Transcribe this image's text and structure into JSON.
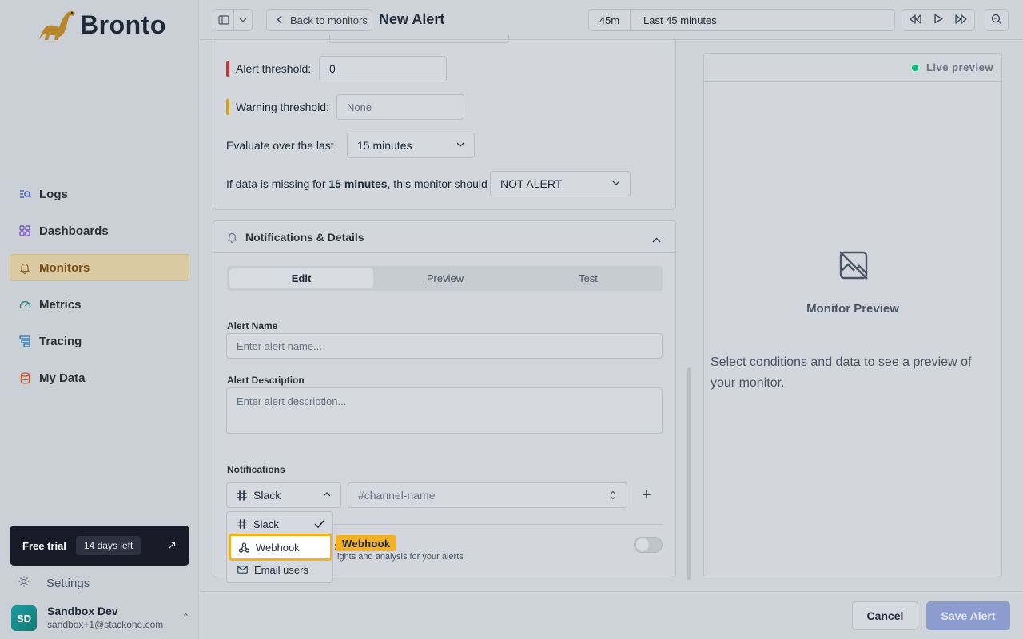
{
  "app": {
    "brand": "Bronto"
  },
  "sidebar": {
    "items": [
      {
        "label": "Logs",
        "icon": "logs-icon"
      },
      {
        "label": "Dashboards",
        "icon": "dashboards-icon"
      },
      {
        "label": "Monitors",
        "icon": "bell-icon",
        "active": true
      },
      {
        "label": "Metrics",
        "icon": "gauge-icon"
      },
      {
        "label": "Tracing",
        "icon": "tracing-icon"
      },
      {
        "label": "My Data",
        "icon": "database-icon"
      }
    ],
    "trial": {
      "title": "Free trial",
      "badge": "14 days left"
    },
    "settings_label": "Settings",
    "user": {
      "initials": "SD",
      "name": "Sandbox Dev",
      "email": "sandbox+1@stackone.com"
    }
  },
  "topbar": {
    "back_label": "Back to monitors",
    "title": "New Alert",
    "time_short": "45m",
    "time_long": "Last 45 minutes"
  },
  "conditions": {
    "alert_threshold_label": "Alert threshold:",
    "alert_threshold_value": "0",
    "warning_threshold_label": "Warning threshold:",
    "warning_threshold_placeholder": "None",
    "evaluate_label": "Evaluate over the last",
    "evaluate_value": "15 minutes",
    "missing_prefix": "If data is missing for ",
    "missing_bold": "15 minutes",
    "missing_suffix": ", this monitor should",
    "missing_value": "NOT ALERT"
  },
  "notifications": {
    "section_title": "Notifications & Details",
    "tabs": [
      "Edit",
      "Preview",
      "Test"
    ],
    "alert_name_label": "Alert Name",
    "alert_name_placeholder": "Enter alert name...",
    "alert_desc_label": "Alert Description",
    "alert_desc_placeholder": "Enter alert description...",
    "notifications_label": "Notifications",
    "channel_type": "Slack",
    "channel_placeholder": "#channel-name",
    "insights_text": "ights and analysis for your alerts",
    "dropdown_options": [
      "Slack",
      "Webhook",
      "Email users"
    ],
    "hint_label": "Webhook"
  },
  "preview": {
    "live_label": "Live preview",
    "title": "Monitor Preview",
    "message": "Select conditions and data to see a preview of your monitor."
  },
  "footer": {
    "cancel_label": "Cancel",
    "save_label": "Save Alert"
  },
  "colors": {
    "accent": "#f4b223",
    "alert_bar": "#c8323c",
    "warning_bar": "#d4a017",
    "primary": "#8c9ccf"
  }
}
